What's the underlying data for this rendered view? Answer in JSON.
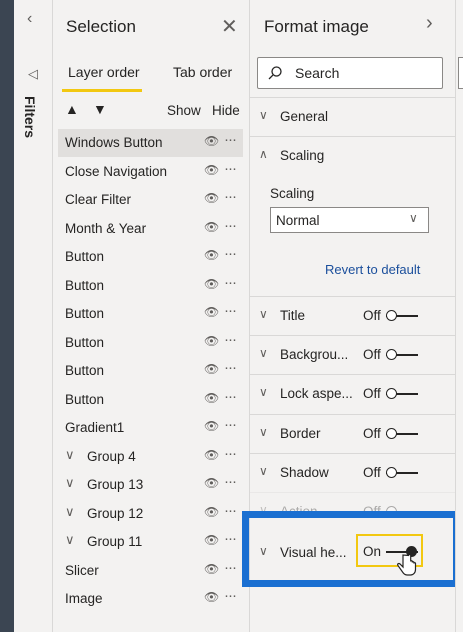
{
  "filters": {
    "label": "Filters"
  },
  "selection": {
    "title": "Selection",
    "tabs": [
      "Layer order",
      "Tab order"
    ],
    "show_label": "Show",
    "hide_label": "Hide",
    "items": [
      {
        "label": "Windows Button",
        "group": false,
        "selected": true
      },
      {
        "label": "Close Navigation",
        "group": false
      },
      {
        "label": "Clear Filter",
        "group": false
      },
      {
        "label": "Month & Year",
        "group": false
      },
      {
        "label": "Button",
        "group": false
      },
      {
        "label": "Button",
        "group": false
      },
      {
        "label": "Button",
        "group": false
      },
      {
        "label": "Button",
        "group": false
      },
      {
        "label": "Button",
        "group": false
      },
      {
        "label": "Button",
        "group": false
      },
      {
        "label": "Gradient1",
        "group": false
      },
      {
        "label": "Group 4",
        "group": true
      },
      {
        "label": "Group 13",
        "group": true
      },
      {
        "label": "Group 12",
        "group": true
      },
      {
        "label": "Group 11",
        "group": true
      },
      {
        "label": "Slicer",
        "group": false
      },
      {
        "label": "Image",
        "group": false
      }
    ]
  },
  "format": {
    "title": "Format image",
    "search_placeholder": "Search",
    "general": "General",
    "scaling_section": "Scaling",
    "scaling_label": "Scaling",
    "scaling_value": "Normal",
    "revert": "Revert to default",
    "sections": [
      {
        "label": "Title",
        "state": "Off"
      },
      {
        "label": "Backgrou...",
        "state": "Off"
      },
      {
        "label": "Lock aspe...",
        "state": "Off"
      },
      {
        "label": "Border",
        "state": "Off"
      },
      {
        "label": "Shadow",
        "state": "Off"
      },
      {
        "label": "Action",
        "state": "Off"
      }
    ],
    "visual_header": {
      "label": "Visual he...",
      "state": "On"
    }
  },
  "colors": {
    "accent_tab": "#f2c811",
    "highlight_box": "#1a6fd1",
    "on_box": "#f2c811"
  }
}
